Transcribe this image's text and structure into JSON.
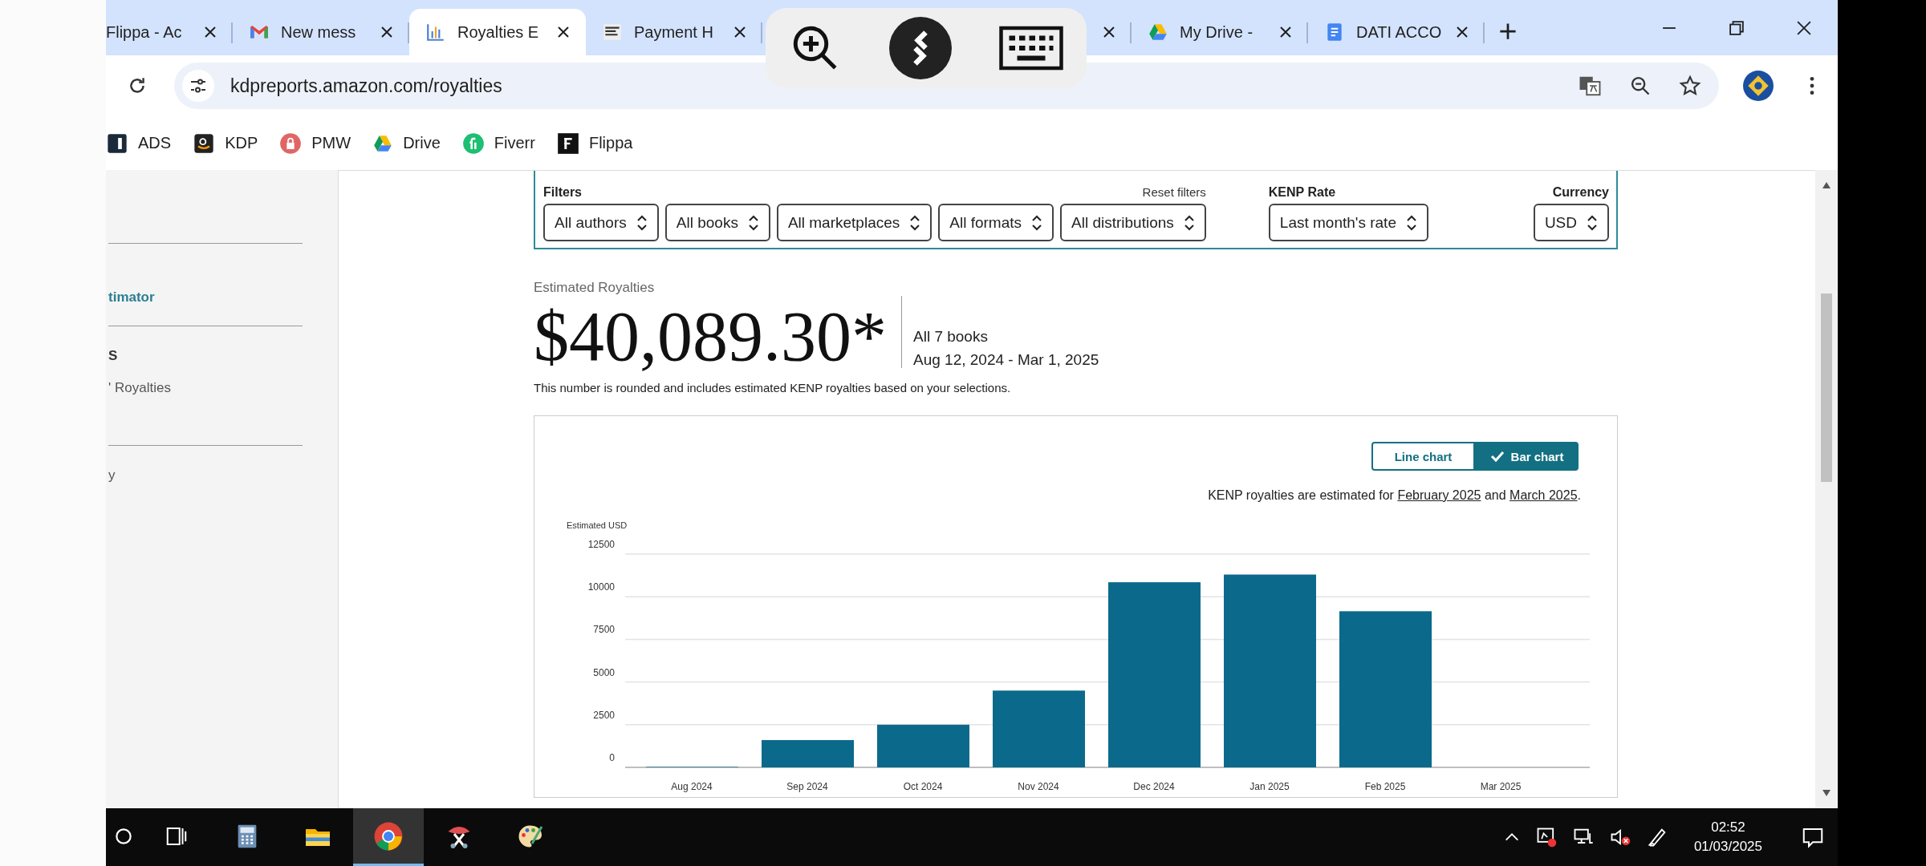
{
  "tabs": [
    {
      "kind": "plain",
      "title": "Flippa - Ac",
      "selected": false
    },
    {
      "kind": "gmail",
      "title": "New mess",
      "selected": false
    },
    {
      "kind": "chart",
      "title": "Royalties E",
      "selected": true
    },
    {
      "kind": "flippa",
      "title": "Payment H",
      "selected": false
    },
    {
      "kind": "covered",
      "selected": false
    },
    {
      "kind": "drive",
      "title": "My Drive -",
      "selected": false
    },
    {
      "kind": "docs",
      "title": "DATI ACCO",
      "selected": false
    }
  ],
  "address_bar": {
    "url": "kdpreports.amazon.com/royalties"
  },
  "bookmarks": [
    {
      "kind": "ads",
      "label": "ADS"
    },
    {
      "kind": "kdp",
      "label": "KDP"
    },
    {
      "kind": "pmw",
      "label": "PMW"
    },
    {
      "kind": "drive",
      "label": "Drive"
    },
    {
      "kind": "fiverr",
      "label": "Fiverr"
    },
    {
      "kind": "flippa",
      "label": "Flippa"
    }
  ],
  "sidebar": {
    "groups": [
      {
        "items": [
          {
            "kind": "link",
            "label": "timator",
            "selected": true
          }
        ]
      },
      {
        "items": [
          {
            "kind": "heading",
            "label": "S"
          },
          {
            "kind": "link",
            "label": "' Royalties",
            "selected": false
          }
        ]
      },
      {
        "items": [
          {
            "kind": "link",
            "label": "y",
            "selected": false
          }
        ]
      }
    ]
  },
  "filters": {
    "title": "Filters",
    "reset": "Reset filters",
    "dropdowns": [
      "All authors",
      "All books",
      "All marketplaces",
      "All formats",
      "All distributions"
    ],
    "kenp": {
      "label": "KENP Rate",
      "value": "Last month's rate"
    },
    "currency": {
      "label": "Currency",
      "value": "USD"
    }
  },
  "summary": {
    "label": "Estimated Royalties",
    "amount": "$40,089.30*",
    "books": "All 7 books",
    "range": "Aug 12, 2024 - Mar 1, 2025",
    "note": "This number is rounded and includes estimated KENP royalties based on your selections."
  },
  "chart_card": {
    "view_toggle": [
      {
        "label": "Line chart",
        "selected": false
      },
      {
        "label": "Bar chart",
        "selected": true
      }
    ],
    "kenp_note": [
      {
        "kind": "text",
        "text": "KENP royalties are estimated for "
      },
      {
        "kind": "link",
        "text": "February 2025"
      },
      {
        "kind": "text",
        "text": " and "
      },
      {
        "kind": "link",
        "text": "March 2025"
      },
      {
        "kind": "text",
        "text": "."
      }
    ],
    "chart_data": {
      "type": "bar",
      "ylabel": "Estimated USD",
      "categories": [
        "Aug 2024",
        "Sep 2024",
        "Oct 2024",
        "Nov 2024",
        "Dec 2024",
        "Jan 2025",
        "Feb 2025",
        "Mar 2025"
      ],
      "values": [
        30,
        1600,
        2500,
        4500,
        10850,
        11300,
        9150,
        0
      ],
      "grid": true,
      "ylim": [
        0,
        12500
      ],
      "yticks": [
        0,
        2500,
        5000,
        7500,
        10000,
        12500
      ]
    }
  },
  "taskbar": {
    "apps": [
      {
        "kind": "search",
        "selected": false
      },
      {
        "kind": "taskview",
        "selected": false
      },
      {
        "kind": "calculator",
        "selected": false
      },
      {
        "kind": "explorer",
        "selected": false
      },
      {
        "kind": "chrome",
        "selected": true
      },
      {
        "kind": "snipping",
        "selected": false
      },
      {
        "kind": "paint",
        "selected": false
      }
    ],
    "clock": {
      "time": "02:52",
      "date": "01/03/2025"
    }
  }
}
